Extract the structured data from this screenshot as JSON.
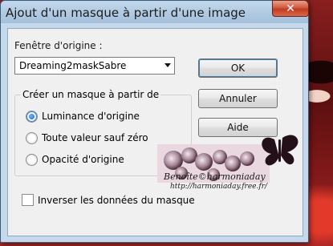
{
  "dialog": {
    "title": "Ajout d'un masque à partir d'une image",
    "close_glyph": "✕",
    "source_window_label": "Fenêtre d'origine :",
    "source_window_value": "Dreaming2maskSabre",
    "group_title": "Créer un masque à partir de",
    "options": [
      {
        "label": "Luminance d'origine",
        "checked": true
      },
      {
        "label": "Toute valeur sauf zéro",
        "checked": false
      },
      {
        "label": "Opacité d'origine",
        "checked": false
      }
    ],
    "invert_label": "Inverser les données du masque",
    "invert_checked": false,
    "buttons": {
      "ok": "OK",
      "cancel": "Annuler",
      "help": "Aide"
    }
  },
  "watermark": {
    "signature": "Benoîte©harmoniaday",
    "url": "http://harmoniaday.free.fr/"
  },
  "colors": {
    "accent": "#3c7fb1",
    "titlebar": "#b2cbe3",
    "background": "#6b1414"
  }
}
